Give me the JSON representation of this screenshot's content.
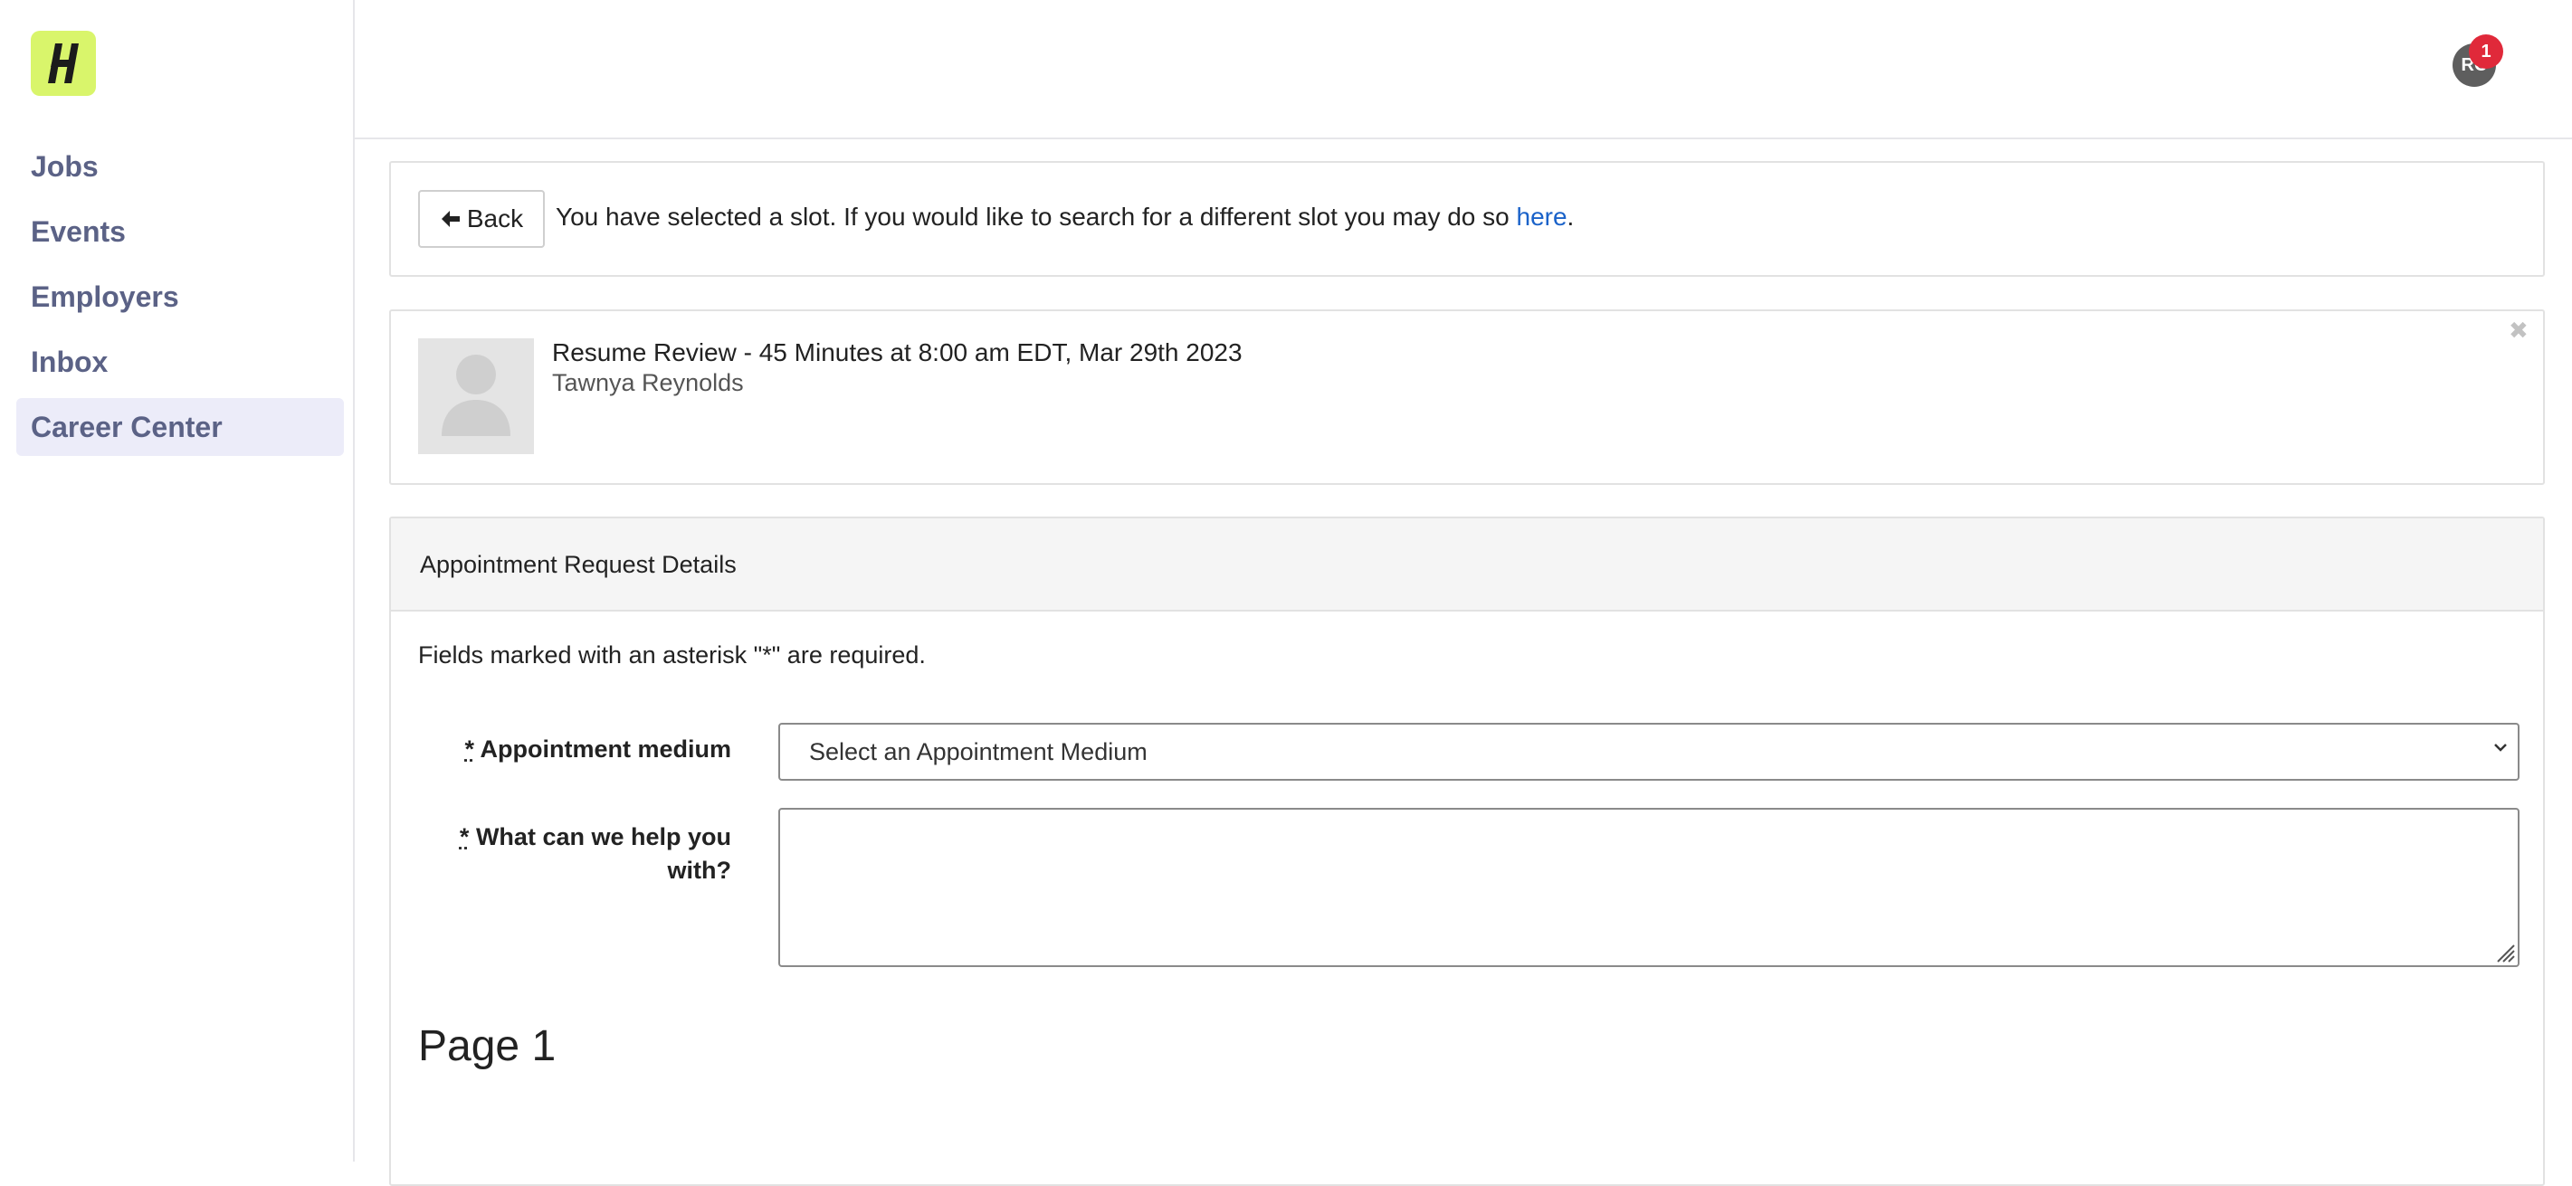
{
  "brand": {
    "logo_text": "H",
    "logo_color": "#d9f56b"
  },
  "sidebar": {
    "items": [
      {
        "label": "Jobs",
        "active": false
      },
      {
        "label": "Events",
        "active": false
      },
      {
        "label": "Employers",
        "active": false
      },
      {
        "label": "Inbox",
        "active": false
      },
      {
        "label": "Career Center",
        "active": true
      }
    ]
  },
  "header": {
    "avatar_initials": "RC",
    "notification_count": "1"
  },
  "notice": {
    "back_label": "Back",
    "message": "You have selected a slot. If you would like to search for a different slot you may do so ",
    "link_text": "here",
    "link_suffix": "."
  },
  "slot": {
    "title": "Resume Review - 45 Minutes at 8:00 am EDT, Mar 29th 2023",
    "advisor": "Tawnya Reynolds",
    "close_icon": "✖"
  },
  "form": {
    "section_title": "Appointment Request Details",
    "required_note": "Fields marked with an asterisk \"*\" are required.",
    "asterisk": "*",
    "medium_label": "Appointment medium",
    "medium_selected": "Select an Appointment Medium",
    "help_label": "What can we help you with?",
    "help_value": ""
  },
  "page_heading": "Page 1"
}
